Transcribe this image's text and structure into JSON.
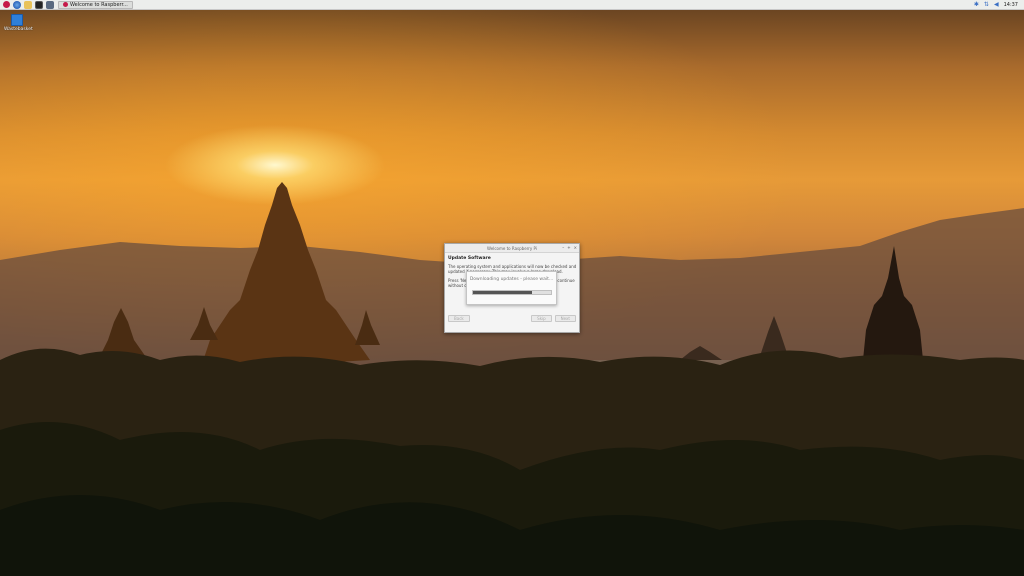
{
  "taskbar": {
    "launchers": [
      "raspberry-menu-icon",
      "web-browser-icon",
      "file-manager-icon",
      "terminal-icon",
      "task-manager-icon"
    ],
    "task_label": "Welcome to Raspberr...",
    "clock": "14:37",
    "tray_icons": [
      "bluetooth-icon",
      "network-icon",
      "volume-icon"
    ]
  },
  "desktop": {
    "icons": [
      {
        "label": "Wastebasket",
        "icon": "trash-icon"
      }
    ]
  },
  "dialog": {
    "title": "Welcome to Raspberry Pi",
    "heading": "Update Software",
    "text_line1": "The operating system and applications will now be checked and",
    "text_line2": "updated if necessary. This may involve a large download.",
    "text_line3": "Press 'Next' to check and update software, or 'Skip' to continue",
    "text_line4": "without checking.",
    "buttons": {
      "back": "Back",
      "skip": "Skip",
      "next": "Next"
    },
    "controls": {
      "minimize": "–",
      "maximize": "+",
      "close": "×"
    }
  },
  "progress": {
    "message": "Downloading updates - please wait...",
    "fraction": 0.76
  },
  "colors": {
    "panel_bg": "#eceeec",
    "accent_rpi": "#c51a4a",
    "tray_blue": "#3a6fc4"
  }
}
